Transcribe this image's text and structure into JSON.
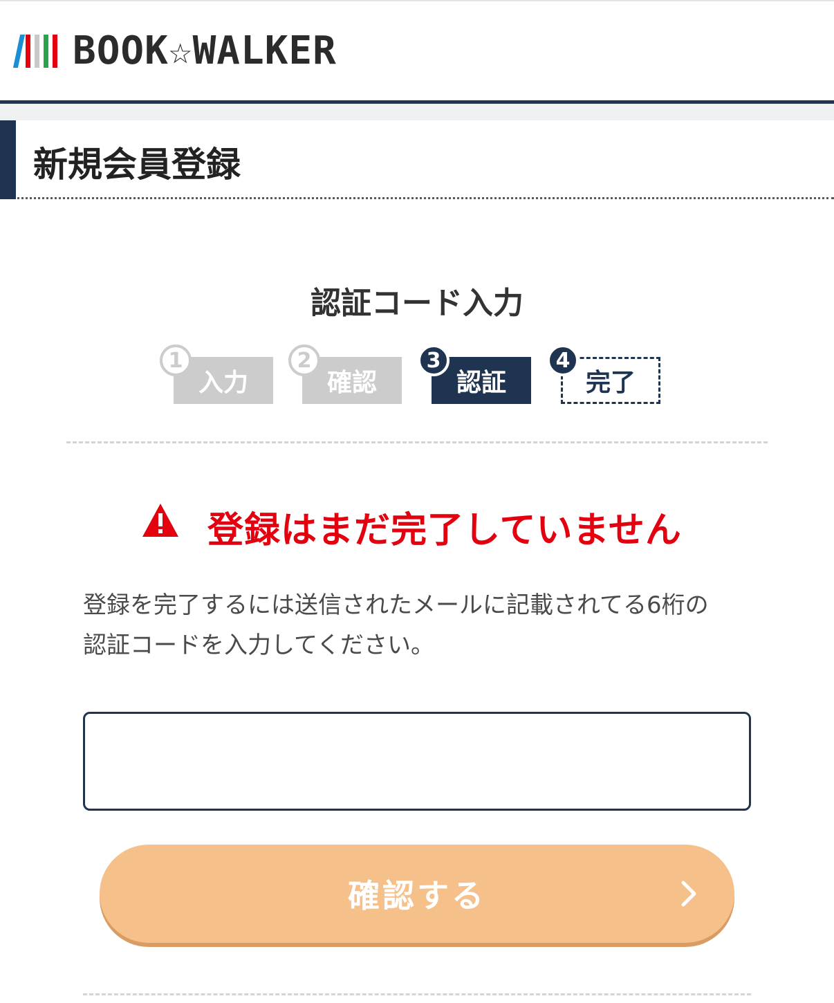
{
  "header": {
    "logo_text": "BOOK☆WALKER",
    "logo_bar_colors": [
      "#1b8fd6",
      "#e3000f",
      "#c8c8c8",
      "#2ca24a",
      "#e3000f"
    ]
  },
  "page": {
    "title": "新規会員登録",
    "section_heading": "認証コード入力"
  },
  "steps": [
    {
      "number": "1",
      "label": "入力",
      "state": "done"
    },
    {
      "number": "2",
      "label": "確認",
      "state": "done"
    },
    {
      "number": "3",
      "label": "認証",
      "state": "current"
    },
    {
      "number": "4",
      "label": "完了",
      "state": "todo"
    }
  ],
  "warning": {
    "icon": "warning-triangle-icon",
    "text": "登録はまだ完了していません",
    "color": "#e3000f"
  },
  "instruction": {
    "line1": "登録を完了するには送信されたメールに記載されてる6桁の",
    "line2": "認証コードを入力してください。"
  },
  "form": {
    "code_value": "",
    "code_placeholder": "",
    "submit_label": "確認する",
    "submit_icon": "chevron-right-icon"
  },
  "colors": {
    "accent": "#1f3450",
    "button": "#f6c08a",
    "error": "#e3000f",
    "step_inactive": "#cccccc"
  }
}
